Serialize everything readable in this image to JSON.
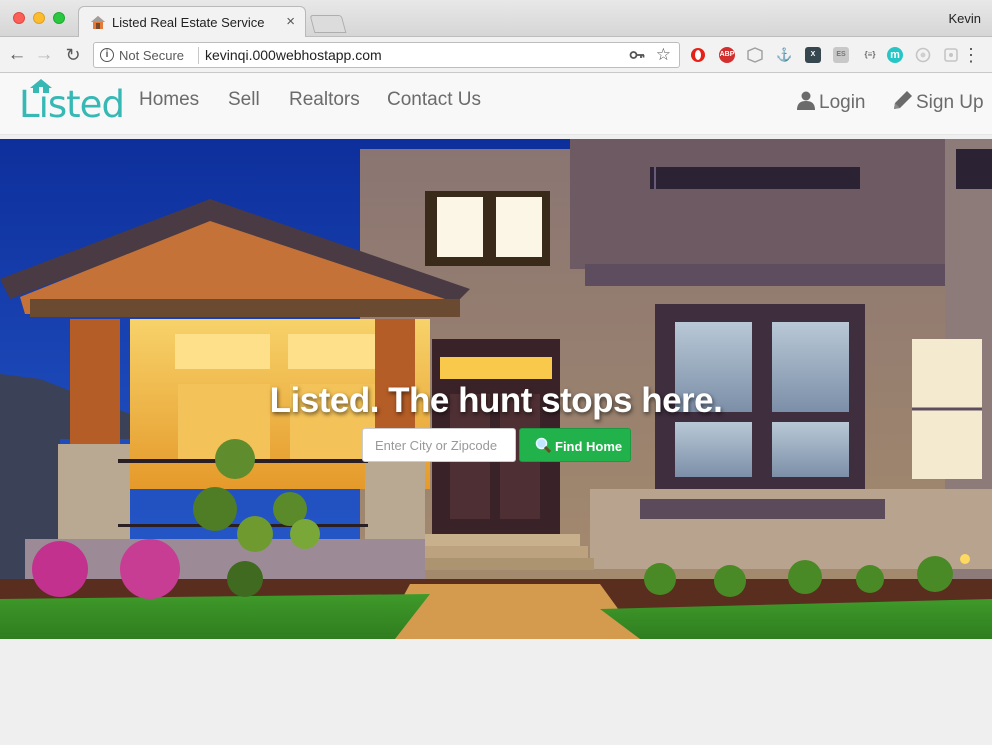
{
  "browser": {
    "tab_title": "Listed Real Estate Service",
    "tab_close": "×",
    "profile_name": "Kevin",
    "security_label": "Not Secure",
    "url": "kevinqi.000webhostapp.com",
    "nav_back": "←",
    "nav_forward": "→",
    "nav_reload": "↻",
    "menu": "⋮",
    "extensions": [
      {
        "icon": "opera-icon",
        "color": "#e62117",
        "label": ""
      },
      {
        "icon": "adblock-icon",
        "color": "#d32f2f",
        "label": "ABP"
      },
      {
        "icon": "shield-ext-icon",
        "color": "#bdbdbd",
        "label": ""
      },
      {
        "icon": "anchor-ext-icon",
        "color": "#cfcfcf",
        "label": ""
      },
      {
        "icon": "x-ext-icon",
        "color": "#37474f",
        "label": "X"
      },
      {
        "icon": "es-ext-icon",
        "color": "#c8c8c8",
        "label": "ES"
      },
      {
        "icon": "json-ext-icon",
        "color": "#e0e0e0",
        "label": "{≡}"
      },
      {
        "icon": "m-ext-icon",
        "color": "#26c6c6",
        "label": "m"
      },
      {
        "icon": "circle-ext-icon",
        "color": "#d5d5d5",
        "label": ""
      },
      {
        "icon": "puzzle-ext-icon",
        "color": "#d0d0d0",
        "label": ""
      }
    ]
  },
  "site": {
    "logo_text": "Listed",
    "brand_color": "#36b8b5",
    "nav_links": [
      "Homes",
      "Sell",
      "Realtors",
      "Contact Us"
    ],
    "login_label": "Login",
    "signup_label": "Sign Up"
  },
  "hero": {
    "tagline": "Listed. The hunt stops here.",
    "search_placeholder": "Enter City or Zipcode",
    "search_value": "",
    "button_label": "Find Home",
    "button_color": "#22b24c"
  }
}
